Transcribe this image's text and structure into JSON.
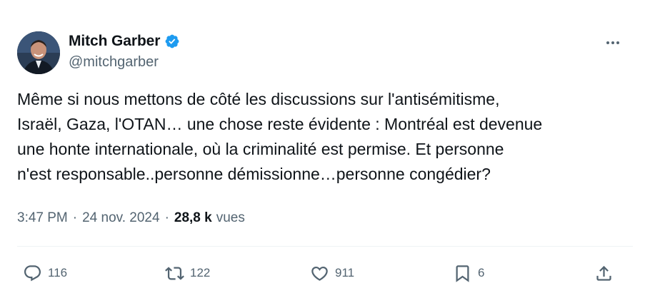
{
  "author": {
    "display_name": "Mitch Garber",
    "handle": "@mitchgarber",
    "verified": true
  },
  "tweet": {
    "lines": [
      "Même si nous mettons de côté les discussions sur l'antisémitisme,",
      "Israël, Gaza, l'OTAN… une chose reste évidente : Montréal est devenue",
      "une honte internationale, où la criminalité est permise. Et personne",
      "n'est responsable..personne démissionne…personne congédier?"
    ]
  },
  "meta": {
    "time": "3:47 PM",
    "separator": "·",
    "date": "24 nov. 2024",
    "views_count": "28,8 k",
    "views_label": "vues"
  },
  "actions": {
    "replies": "116",
    "reposts": "122",
    "likes": "911",
    "bookmarks": "6"
  },
  "icons": {
    "verified": "verified-badge-icon",
    "more": "more-icon",
    "reply": "reply-icon",
    "repost": "repost-icon",
    "like": "heart-icon",
    "bookmark": "bookmark-icon",
    "share": "share-icon"
  },
  "colors": {
    "text": "#0f1419",
    "secondary": "#536471",
    "verified": "#1d9bf0",
    "divider": "#eff3f4"
  }
}
